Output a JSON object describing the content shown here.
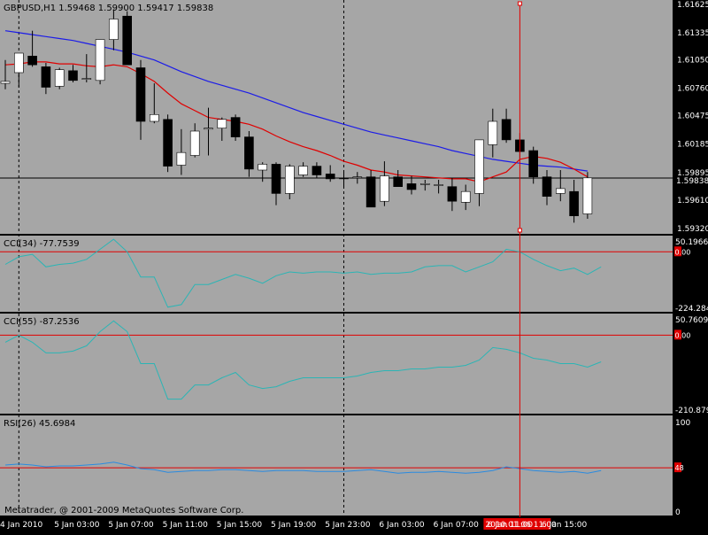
{
  "colors": {
    "background": "#000000",
    "pane": "#A6A6A6",
    "bull_body": "#FFFFFF",
    "bear_body": "#000000",
    "wick": "#000000",
    "ma_fast": "#E00000",
    "ma_slow": "#1C1CE8",
    "indicator_line": "#2BB5B5",
    "rsi_line": "#2A8BE0",
    "level_line": "#E00000",
    "crosshair": "#E00000",
    "label_box": "#E00000",
    "current_price_box": "#000000",
    "text": "#000000"
  },
  "footer_text": "Metatrader, @ 2001-2009 MetaQuotes Software Corp.",
  "chart_data": [
    {
      "id": "price",
      "type": "candlestick",
      "title": "GBPUSD,H1  1.59468 1.59900 1.59417 1.59838",
      "ylim": [
        1.5932,
        1.6162
      ],
      "y_ticks": [
        1.6162,
        1.6133,
        1.6105,
        1.6076,
        1.6048,
        1.6019,
        1.59895,
        1.5961,
        1.5932
      ],
      "y_tick_labels": [
        "1.61625",
        "1.61335",
        "1.61050",
        "1.60760",
        "1.60475",
        "1.60185",
        "1.59895",
        "1.59610",
        "1.59320"
      ],
      "current_price": 1.59838,
      "current_price_label": "1.59838",
      "candles": [
        {
          "o": 1.6081,
          "h": 1.6105,
          "l": 1.6075,
          "c": 1.6083
        },
        {
          "o": 1.6092,
          "h": 1.6111,
          "l": 1.6077,
          "c": 1.6112
        },
        {
          "o": 1.6109,
          "h": 1.6135,
          "l": 1.6098,
          "c": 1.61
        },
        {
          "o": 1.6098,
          "h": 1.6102,
          "l": 1.607,
          "c": 1.6077
        },
        {
          "o": 1.6078,
          "h": 1.6097,
          "l": 1.6075,
          "c": 1.6095
        },
        {
          "o": 1.6094,
          "h": 1.61,
          "l": 1.6082,
          "c": 1.6084
        },
        {
          "o": 1.6086,
          "h": 1.6111,
          "l": 1.6082,
          "c": 1.6086
        },
        {
          "o": 1.6084,
          "h": 1.6126,
          "l": 1.608,
          "c": 1.6126
        },
        {
          "o": 1.6126,
          "h": 1.6157,
          "l": 1.6115,
          "c": 1.6147
        },
        {
          "o": 1.615,
          "h": 1.6155,
          "l": 1.61,
          "c": 1.61
        },
        {
          "o": 1.6097,
          "h": 1.6105,
          "l": 1.6023,
          "c": 1.6042
        },
        {
          "o": 1.6042,
          "h": 1.6081,
          "l": 1.604,
          "c": 1.6049
        },
        {
          "o": 1.6044,
          "h": 1.6049,
          "l": 1.599,
          "c": 1.5996
        },
        {
          "o": 1.5997,
          "h": 1.6034,
          "l": 1.5987,
          "c": 1.601
        },
        {
          "o": 1.6007,
          "h": 1.604,
          "l": 1.6005,
          "c": 1.6032
        },
        {
          "o": 1.6034,
          "h": 1.6056,
          "l": 1.6007,
          "c": 1.6035
        },
        {
          "o": 1.6035,
          "h": 1.6046,
          "l": 1.6022,
          "c": 1.6044
        },
        {
          "o": 1.6046,
          "h": 1.6049,
          "l": 1.6022,
          "c": 1.6026
        },
        {
          "o": 1.6026,
          "h": 1.6032,
          "l": 1.5985,
          "c": 1.5993
        },
        {
          "o": 1.5992,
          "h": 1.6,
          "l": 1.598,
          "c": 1.5998
        },
        {
          "o": 1.5998,
          "h": 1.6,
          "l": 1.5956,
          "c": 1.5968
        },
        {
          "o": 1.5968,
          "h": 1.5998,
          "l": 1.5962,
          "c": 1.5996
        },
        {
          "o": 1.5987,
          "h": 1.6,
          "l": 1.5985,
          "c": 1.5996
        },
        {
          "o": 1.5996,
          "h": 1.6,
          "l": 1.5984,
          "c": 1.5987
        },
        {
          "o": 1.5988,
          "h": 1.5997,
          "l": 1.598,
          "c": 1.5983
        },
        {
          "o": 1.5984,
          "h": 1.5992,
          "l": 1.5973,
          "c": 1.5983
        },
        {
          "o": 1.5985,
          "h": 1.599,
          "l": 1.5978,
          "c": 1.5985
        },
        {
          "o": 1.5985,
          "h": 1.5992,
          "l": 1.5954,
          "c": 1.5954
        },
        {
          "o": 1.596,
          "h": 1.6001,
          "l": 1.5955,
          "c": 1.5986
        },
        {
          "o": 1.5985,
          "h": 1.5992,
          "l": 1.5976,
          "c": 1.5975
        },
        {
          "o": 1.5978,
          "h": 1.5986,
          "l": 1.5967,
          "c": 1.5972
        },
        {
          "o": 1.5978,
          "h": 1.5982,
          "l": 1.5971,
          "c": 1.5978
        },
        {
          "o": 1.5977,
          "h": 1.5982,
          "l": 1.5968,
          "c": 1.5977
        },
        {
          "o": 1.5975,
          "h": 1.5984,
          "l": 1.595,
          "c": 1.596
        },
        {
          "o": 1.5959,
          "h": 1.5977,
          "l": 1.5951,
          "c": 1.597
        },
        {
          "o": 1.5968,
          "h": 1.6023,
          "l": 1.5955,
          "c": 1.6023
        },
        {
          "o": 1.6018,
          "h": 1.6055,
          "l": 1.6005,
          "c": 1.6042
        },
        {
          "o": 1.6044,
          "h": 1.6055,
          "l": 1.602,
          "c": 1.6023
        },
        {
          "o": 1.6023,
          "h": 1.603,
          "l": 1.6003,
          "c": 1.6011
        },
        {
          "o": 1.6012,
          "h": 1.6016,
          "l": 1.5978,
          "c": 1.5985
        },
        {
          "o": 1.5985,
          "h": 1.5992,
          "l": 1.5956,
          "c": 1.5965
        },
        {
          "o": 1.5968,
          "h": 1.5992,
          "l": 1.596,
          "c": 1.5973
        },
        {
          "o": 1.597,
          "h": 1.5982,
          "l": 1.5938,
          "c": 1.5945
        },
        {
          "o": 1.5947,
          "h": 1.599,
          "l": 1.5942,
          "c": 1.5984
        }
      ],
      "ma_fast": [
        1.61,
        1.6101,
        1.6103,
        1.6103,
        1.6101,
        1.6101,
        1.6099,
        1.6098,
        1.61,
        1.6098,
        1.6091,
        1.6083,
        1.6071,
        1.606,
        1.6053,
        1.6046,
        1.6044,
        1.6042,
        1.6039,
        1.6034,
        1.6027,
        1.6021,
        1.6016,
        1.6012,
        1.6007,
        1.6001,
        1.5997,
        1.5992,
        1.599,
        1.5987,
        1.5986,
        1.5985,
        1.5984,
        1.5983,
        1.5983,
        1.598,
        1.5985,
        1.599,
        1.6003,
        1.6006,
        1.6004,
        1.6,
        1.5993,
        1.5985
      ],
      "ma_slow": [
        1.6135,
        1.6133,
        1.6131,
        1.6129,
        1.6127,
        1.6125,
        1.6122,
        1.6119,
        1.6116,
        1.6113,
        1.6109,
        1.6105,
        1.6099,
        1.6093,
        1.6088,
        1.6083,
        1.6079,
        1.6075,
        1.6071,
        1.6066,
        1.6061,
        1.6056,
        1.6051,
        1.6047,
        1.6043,
        1.6039,
        1.6035,
        1.6031,
        1.6028,
        1.6025,
        1.6022,
        1.6019,
        1.6016,
        1.6012,
        1.6009,
        1.6006,
        1.6003,
        1.6001,
        1.5999,
        1.5997,
        1.5996,
        1.5995,
        1.5993,
        1.5991
      ],
      "x_tick_labels": [
        "4 Jan 2010",
        "5 Jan 03:00",
        "5 Jan 07:00",
        "5 Jan 11:00",
        "5 Jan 15:00",
        "5 Jan 19:00",
        "5 Jan 23:00",
        "6 Jan 03:00",
        "6 Jan 07:00",
        "6 Jan 11:00",
        "6 Jan 15:00"
      ],
      "x_tick_indices": [
        0,
        4,
        8,
        12,
        16,
        20,
        24,
        28,
        32,
        36,
        40
      ],
      "crosshair_index": 38,
      "crosshair_label": "2010.01.06 11:00",
      "separator_indices": [
        1,
        25
      ]
    },
    {
      "id": "cci34",
      "type": "line",
      "title": "CCI(34) -77.7539",
      "ylim": [
        -224.284,
        50.1966
      ],
      "y_tick_labels": [
        "50.1966",
        "-224.284"
      ],
      "level": 0,
      "level_label": "0.00",
      "values": [
        -50,
        -20,
        -10,
        -60,
        -50,
        -45,
        -30,
        10,
        50,
        0,
        -100,
        -100,
        -220,
        -210,
        -130,
        -130,
        -110,
        -90,
        -105,
        -125,
        -95,
        -80,
        -85,
        -80,
        -80,
        -85,
        -80,
        -90,
        -85,
        -85,
        -80,
        -60,
        -55,
        -55,
        -80,
        -60,
        -40,
        10,
        0,
        -30,
        -55,
        -75,
        -65,
        -90,
        -60
      ]
    },
    {
      "id": "cci55",
      "type": "line",
      "title": "CCI(55) -87.2536",
      "ylim": [
        -210.879,
        50.7609
      ],
      "y_tick_labels": [
        "50.7609",
        "-210.879"
      ],
      "level": 0,
      "level_label": "0.00",
      "values": [
        -20,
        0,
        -20,
        -50,
        -50,
        -45,
        -30,
        10,
        40,
        10,
        -80,
        -80,
        -180,
        -180,
        -140,
        -140,
        -120,
        -105,
        -140,
        -150,
        -145,
        -130,
        -120,
        -120,
        -120,
        -120,
        -115,
        -105,
        -100,
        -100,
        -95,
        -95,
        -90,
        -90,
        -85,
        -70,
        -35,
        -40,
        -50,
        -65,
        -70,
        -80,
        -80,
        -90,
        -75
      ]
    },
    {
      "id": "rsi26",
      "type": "line",
      "title": "RSI(26) 45.6984",
      "ylim": [
        0,
        100
      ],
      "y_tick_labels": [
        "100",
        "0"
      ],
      "level": 48,
      "level_label": "48",
      "values": [
        51,
        52,
        51,
        49,
        50,
        50,
        51,
        52,
        54,
        51,
        47,
        46,
        43,
        44,
        45,
        45,
        46,
        46,
        45,
        44,
        45,
        45,
        45,
        44,
        44,
        44,
        45,
        46,
        44,
        42,
        43,
        43,
        44,
        43,
        42,
        43,
        45,
        49,
        47,
        45,
        44,
        43,
        44,
        42,
        45
      ]
    }
  ]
}
